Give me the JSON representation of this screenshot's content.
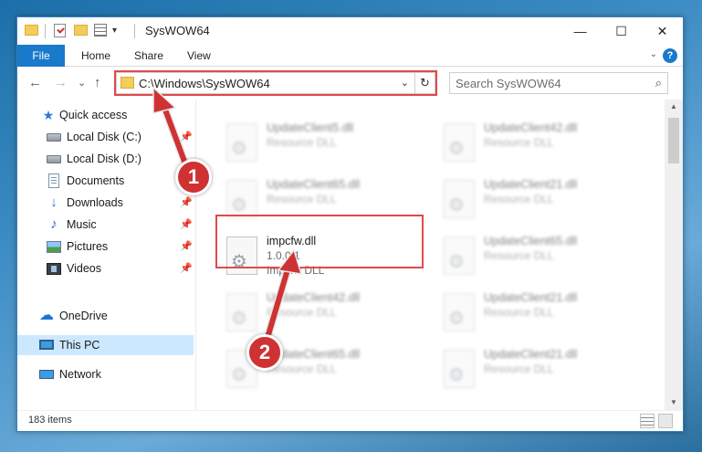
{
  "window": {
    "title": "SysWOW64",
    "minimize_glyph": "—",
    "maximize_glyph": "☐",
    "close_glyph": "✕",
    "quick_access_dropdown_glyph": "▾"
  },
  "ribbon": {
    "tabs": [
      {
        "label": "File"
      },
      {
        "label": "Home"
      },
      {
        "label": "Share"
      },
      {
        "label": "View"
      }
    ],
    "expand_glyph": "⌄",
    "help_glyph": "?"
  },
  "navigation": {
    "back_glyph": "←",
    "forward_glyph": "→",
    "recent_glyph": "⌄",
    "up_glyph": "↑",
    "address": "C:\\Windows\\SysWOW64",
    "address_dropdown_glyph": "⌄",
    "refresh_glyph": "↻",
    "search_placeholder": "Search SysWOW64",
    "search_glyph": "⌕"
  },
  "sidebar": {
    "items": [
      {
        "label": "Quick access",
        "icon": "star-icon",
        "pinned": false
      },
      {
        "label": "Local Disk (C:)",
        "icon": "disk-icon",
        "pinned": true
      },
      {
        "label": "Local Disk (D:)",
        "icon": "disk-icon",
        "pinned": false
      },
      {
        "label": "Documents",
        "icon": "document-icon",
        "pinned": true
      },
      {
        "label": "Downloads",
        "icon": "download-icon",
        "pinned": true
      },
      {
        "label": "Music",
        "icon": "music-icon",
        "pinned": true
      },
      {
        "label": "Pictures",
        "icon": "pictures-icon",
        "pinned": true
      },
      {
        "label": "Videos",
        "icon": "videos-icon",
        "pinned": true
      },
      {
        "label": "OneDrive",
        "icon": "cloud-icon",
        "pinned": false
      },
      {
        "label": "This PC",
        "icon": "pc-icon",
        "pinned": false,
        "selected": true
      },
      {
        "label": "Network",
        "icon": "network-icon",
        "pinned": false
      }
    ],
    "pin_glyph": "📌",
    "star_glyph": "★",
    "download_glyph": "↓",
    "music_glyph": "♪",
    "cloud_glyph": "☁"
  },
  "files": {
    "left_column": [
      {
        "name": "UpdateClient5.dll",
        "type": "Resource DLL",
        "version": ""
      },
      {
        "name": "UpdateClient65.dll",
        "type": "Resource DLL",
        "version": ""
      },
      {
        "name": "impcfw.dll",
        "type": "Impcfw DLL",
        "version": "1.0.0.1",
        "highlighted": true
      },
      {
        "name": "UpdateClient42.dll",
        "type": "Resource DLL",
        "version": ""
      },
      {
        "name": "UpdateClient65.dll",
        "type": "Resource DLL",
        "version": ""
      }
    ],
    "right_column": [
      {
        "name": "UpdateClient42.dll",
        "type": "Resource DLL"
      },
      {
        "name": "UpdateClient21.dll",
        "type": "Resource DLL"
      },
      {
        "name": "UpdateClient65.dll",
        "type": "Resource DLL"
      },
      {
        "name": "UpdateClient21.dll",
        "type": "Resource DLL"
      },
      {
        "name": "UpdateClient21.dll",
        "type": "Resource DLL"
      }
    ]
  },
  "scrollbar": {
    "up_glyph": "▲",
    "down_glyph": "▼"
  },
  "status": {
    "item_count": "183 items"
  },
  "annotations": {
    "step1": "1",
    "step2": "2",
    "color": "#cf3232"
  }
}
